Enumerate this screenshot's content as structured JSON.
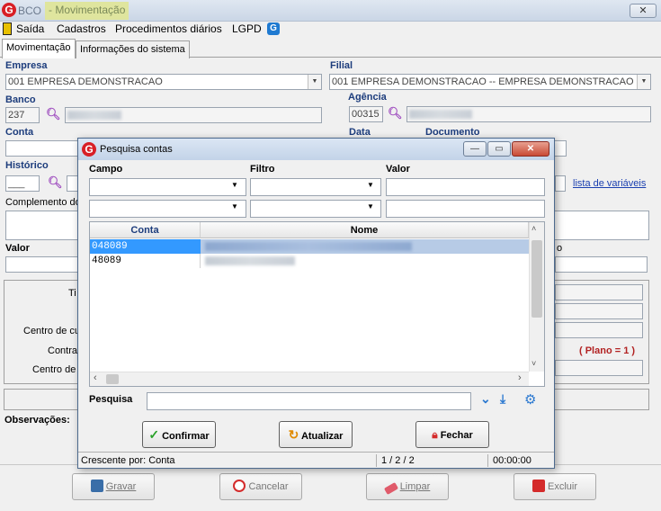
{
  "window": {
    "app_name": "BCO",
    "title": "- Movimentação",
    "close": "✕"
  },
  "menu": {
    "exit": "Saída",
    "register": "Cadastros",
    "daily": "Procedimentos diários",
    "lgpd": "LGPD"
  },
  "tabs": [
    "Movimentação",
    "Informações do sistema"
  ],
  "form": {
    "empresa_label": "Empresa",
    "empresa_value": "001 EMPRESA DEMONSTRACAO",
    "filial_label": "Filial",
    "filial_value": "001 EMPRESA DEMONSTRACAO -- EMPRESA DEMONSTRACAO",
    "banco_label": "Banco",
    "banco_value": "237",
    "agencia_label": "Agência",
    "agencia_value": "00315",
    "conta_label": "Conta",
    "data_label": "Data",
    "documento_label": "Documento",
    "historico_label": "Histórico",
    "historico_value": "___",
    "variables_link": "lista de variáveis",
    "complemento_label": "Complemento do",
    "valor_label": "Valor",
    "o_label": "o",
    "ti_label": "Ti",
    "centro_cu_label": "Centro de cu",
    "contrap_label": "Contrap",
    "centro_de_label": "Centro de",
    "plano_text": "( Plano = 1 )",
    "observacoes_label": "Observações:"
  },
  "footer_buttons": {
    "save": "Gravar",
    "cancel": "Cancelar",
    "clear": "Limpar",
    "delete": "Excluir"
  },
  "dialog": {
    "title": "Pesquisa contas",
    "campo_label": "Campo",
    "filtro_label": "Filtro",
    "valor_label": "Valor",
    "columns": [
      "Conta",
      "Nome"
    ],
    "rows": [
      {
        "conta": "048089"
      },
      {
        "conta": "48089"
      }
    ],
    "pesquisa_label": "Pesquisa",
    "confirm": "Confirmar",
    "refresh": "Atualizar",
    "close": "Fechar",
    "status_sort": "Crescente por: Conta",
    "status_count": "1 / 2 / 2",
    "status_time": "00:00:00"
  },
  "colors": {
    "accent": "#1c3c7c",
    "selection": "#3399ff",
    "close_red": "#d42b2b"
  }
}
